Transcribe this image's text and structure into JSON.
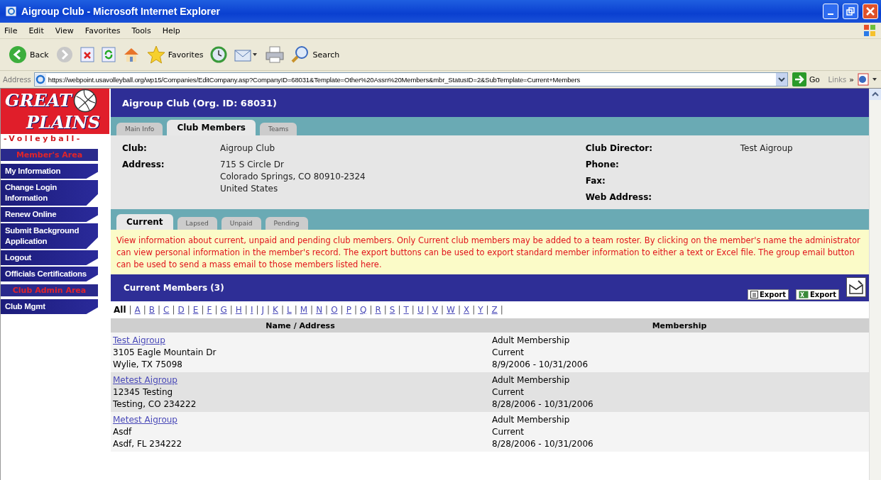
{
  "window": {
    "title": "Aigroup Club - Microsoft Internet Explorer"
  },
  "menu": [
    "File",
    "Edit",
    "View",
    "Favorites",
    "Tools",
    "Help"
  ],
  "toolbar": [
    {
      "kind": "back",
      "label": "Back"
    },
    {
      "kind": "forward"
    },
    {
      "kind": "stop"
    },
    {
      "kind": "refresh"
    },
    {
      "kind": "home"
    },
    {
      "kind": "favorites",
      "label": "Favorites"
    },
    {
      "kind": "history"
    },
    {
      "kind": "mail"
    },
    {
      "kind": "print"
    },
    {
      "kind": "search",
      "label": "Search"
    }
  ],
  "address": {
    "label": "Address",
    "value": "https://webpoint.usavolleyball.org/wp15/Companies/EditCompany.asp?CompanyID=68031&Template=Other%20Assn%20Members&mbr_StatusID=2&SubTemplate=Current+Members",
    "go": "Go",
    "links": "Links",
    "chevron": "»"
  },
  "sidebar": {
    "logo": {
      "line1": "GREAT",
      "line2": "PLAINS",
      "line3": "-Volleyball-"
    },
    "items": [
      {
        "kind": "header",
        "label": "Member's Area"
      },
      {
        "kind": "link",
        "label": "My Information"
      },
      {
        "kind": "link",
        "label": "Change Login Information"
      },
      {
        "kind": "link",
        "label": "Renew Online"
      },
      {
        "kind": "link",
        "label": "Submit Background Application"
      },
      {
        "kind": "link",
        "label": "Logout"
      },
      {
        "kind": "link",
        "label": "Officials Certifications"
      },
      {
        "kind": "header",
        "label": "Club Admin Area"
      },
      {
        "kind": "link",
        "label": "Club Mgmt"
      }
    ]
  },
  "page_title": "Aigroup Club (Org. ID: 68031)",
  "tabs": [
    {
      "label": "Main Info",
      "selected": false
    },
    {
      "label": "Club Members",
      "selected": true
    },
    {
      "label": "Teams",
      "selected": false
    }
  ],
  "details_left": [
    {
      "label": "Club:",
      "lines": [
        "Aigroup Club"
      ]
    },
    {
      "label": "Address:",
      "lines": [
        "715 S Circle Dr",
        "Colorado Springs, CO  80910-2324",
        "United States"
      ]
    }
  ],
  "details_right": [
    {
      "label": "Club Director:",
      "value": "Test Aigroup"
    },
    {
      "label": "Phone:"
    },
    {
      "label": "Fax:"
    },
    {
      "label": "Web Address:"
    }
  ],
  "subtabs": [
    {
      "label": "Current",
      "selected": true
    },
    {
      "label": "Lapsed",
      "selected": false
    },
    {
      "label": "Unpaid",
      "selected": false
    },
    {
      "label": "Pending",
      "selected": false
    }
  ],
  "notice": "View information about current, unpaid and pending club members. Only Current club members may be added to a team roster. By clicking on the member's name the administrator can view personal information in the member's record. The export buttons can be used to export standard member information to either a text or Excel file. The group email button can be used to send a mass email to those members listed here.",
  "members_header": "Current Members (3)",
  "export_buttons": [
    {
      "kind": "text",
      "label": "Export"
    },
    {
      "kind": "excel",
      "label": "Export"
    }
  ],
  "letters": [
    {
      "label": "All",
      "selected": true
    },
    {
      "label": "A",
      "selected": false
    },
    {
      "label": "B",
      "selected": false
    },
    {
      "label": "C",
      "selected": false
    },
    {
      "label": "D",
      "selected": false
    },
    {
      "label": "E",
      "selected": false
    },
    {
      "label": "F",
      "selected": false
    },
    {
      "label": "G",
      "selected": false
    },
    {
      "label": "H",
      "selected": false
    },
    {
      "label": "I",
      "selected": false
    },
    {
      "label": "J",
      "selected": false
    },
    {
      "label": "K",
      "selected": false
    },
    {
      "label": "L",
      "selected": false
    },
    {
      "label": "M",
      "selected": false
    },
    {
      "label": "N",
      "selected": false
    },
    {
      "label": "O",
      "selected": false
    },
    {
      "label": "P",
      "selected": false
    },
    {
      "label": "Q",
      "selected": false
    },
    {
      "label": "R",
      "selected": false
    },
    {
      "label": "S",
      "selected": false
    },
    {
      "label": "T",
      "selected": false
    },
    {
      "label": "U",
      "selected": false
    },
    {
      "label": "V",
      "selected": false
    },
    {
      "label": "W",
      "selected": false
    },
    {
      "label": "X",
      "selected": false
    },
    {
      "label": "Y",
      "selected": false
    },
    {
      "label": "Z",
      "selected": false
    }
  ],
  "separator": "|",
  "table": {
    "columns": [
      "Name / Address",
      "Membership"
    ],
    "rows": [
      {
        "name": "Test Aigroup",
        "address": [
          "3105 Eagle Mountain Dr",
          "Wylie, TX  75098"
        ],
        "membership": [
          "Adult Membership",
          "Current",
          "8/9/2006 - 10/31/2006"
        ]
      },
      {
        "name": "Metest Aigroup",
        "address": [
          "12345 Testing",
          "Testing, CO  234222"
        ],
        "membership": [
          "Adult Membership",
          "Current",
          "8/28/2006 - 10/31/2006"
        ]
      },
      {
        "name": "Metest Aigroup",
        "address": [
          "Asdf",
          "Asdf, FL  234222"
        ],
        "membership": [
          "Adult Membership",
          "Current",
          "8/28/2006 - 10/31/2006"
        ]
      }
    ]
  }
}
